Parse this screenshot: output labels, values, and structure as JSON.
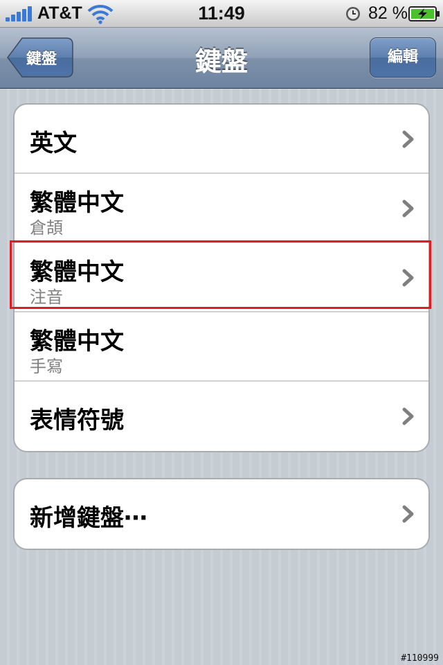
{
  "status_bar": {
    "carrier": "AT&T",
    "time": "11:49",
    "battery_percent": "82 %",
    "icons": [
      "signal-bars-icon",
      "wifi-icon",
      "alarm-clock-icon",
      "battery-charging-icon"
    ]
  },
  "nav_bar": {
    "back_label": "鍵盤",
    "title": "鍵盤",
    "edit_label": "編輯"
  },
  "keyboards": [
    {
      "title": "英文",
      "subtitle": ""
    },
    {
      "title": "繁體中文",
      "subtitle": "倉頡"
    },
    {
      "title": "繁體中文",
      "subtitle": "注音"
    },
    {
      "title": "繁體中文",
      "subtitle": "手寫"
    },
    {
      "title": "表情符號",
      "subtitle": ""
    }
  ],
  "add_keyboard": {
    "label": "新增鍵盤⋯"
  },
  "watermark": "#110999",
  "colors": {
    "nav_bar": "#7e91aa",
    "background": "#c5ccd4",
    "highlight": "#e21b22"
  }
}
